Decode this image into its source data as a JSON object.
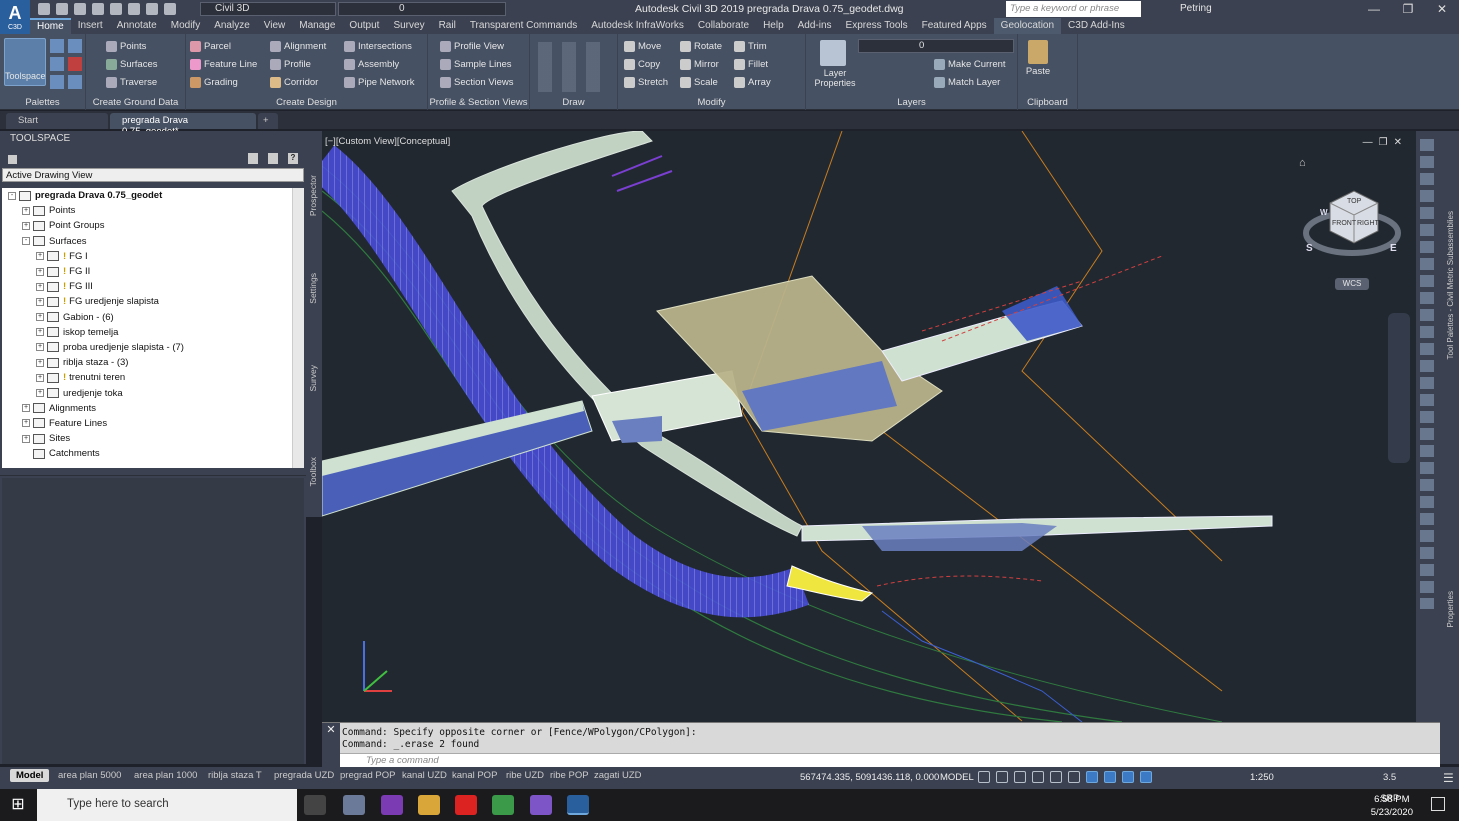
{
  "window": {
    "title": "Autodesk Civil 3D 2019    pregrada Drava 0.75_geodet.dwg",
    "workspace": "Civil 3D",
    "layer_current": "0",
    "search_placeholder": "Type a keyword or phrase",
    "user": "Petring",
    "app_letter": "A",
    "app_sub": "C3D"
  },
  "ribbon_tabs": [
    "Home",
    "Insert",
    "Annotate",
    "Modify",
    "Analyze",
    "View",
    "Manage",
    "Output",
    "Survey",
    "Rail",
    "Transparent Commands",
    "Autodesk InfraWorks",
    "Collaborate",
    "Help",
    "Add-ins",
    "Express Tools",
    "Featured Apps",
    "Geolocation",
    "C3D Add-Ins"
  ],
  "active_tab": "Home",
  "ribbon": {
    "toolspace": "Toolspace",
    "palettes": "Palettes",
    "ground": {
      "title": "Create Ground Data",
      "points": "Points",
      "surfaces": "Surfaces",
      "traverse": "Traverse"
    },
    "design": {
      "title": "Create Design",
      "parcel": "Parcel",
      "feature_line": "Feature Line",
      "grading": "Grading",
      "alignment": "Alignment",
      "profile": "Profile",
      "corridor": "Corridor",
      "intersections": "Intersections",
      "assembly": "Assembly",
      "pipe_network": "Pipe Network"
    },
    "profile_section": {
      "title": "Profile & Section Views",
      "profile_view": "Profile View",
      "sample_lines": "Sample Lines",
      "section_views": "Section Views"
    },
    "draw": {
      "title": "Draw"
    },
    "modify": {
      "title": "Modify",
      "move": "Move",
      "rotate": "Rotate",
      "trim": "Trim",
      "copy": "Copy",
      "mirror": "Mirror",
      "fillet": "Fillet",
      "stretch": "Stretch",
      "scale": "Scale",
      "array": "Array"
    },
    "layers": {
      "title": "Layers",
      "layer_properties": "Layer Properties",
      "make_current": "Make Current",
      "match_layer": "Match Layer",
      "current": "0"
    },
    "clipboard": {
      "title": "Clipboard",
      "paste": "Paste"
    }
  },
  "doc_tabs": [
    "Start",
    "pregrada Drava 0.75_geodet*"
  ],
  "toolspace": {
    "title": "TOOLSPACE",
    "view_select": "Active Drawing View",
    "side_tabs": [
      "Prospector",
      "Settings",
      "Survey",
      "Toolbox"
    ],
    "tree": [
      {
        "label": "pregrada Drava 0.75_geodet",
        "level": 0,
        "exp": "-",
        "bold": true,
        "warn": false
      },
      {
        "label": "Points",
        "level": 1,
        "exp": "+",
        "bold": false,
        "warn": false
      },
      {
        "label": "Point Groups",
        "level": 1,
        "exp": "+",
        "bold": false,
        "warn": false
      },
      {
        "label": "Surfaces",
        "level": 1,
        "exp": "-",
        "bold": false,
        "warn": false
      },
      {
        "label": "FG I",
        "level": 2,
        "exp": "+",
        "bold": false,
        "warn": true
      },
      {
        "label": "FG II",
        "level": 2,
        "exp": "+",
        "bold": false,
        "warn": true
      },
      {
        "label": "FG III",
        "level": 2,
        "exp": "+",
        "bold": false,
        "warn": true
      },
      {
        "label": "FG uredjenje slapista",
        "level": 2,
        "exp": "+",
        "bold": false,
        "warn": true
      },
      {
        "label": "Gabion - (6)",
        "level": 2,
        "exp": "+",
        "bold": false,
        "warn": false
      },
      {
        "label": "iskop temelja",
        "level": 2,
        "exp": "+",
        "bold": false,
        "warn": false
      },
      {
        "label": "proba uredjenje slapista - (7)",
        "level": 2,
        "exp": "+",
        "bold": false,
        "warn": false
      },
      {
        "label": "riblja staza - (3)",
        "level": 2,
        "exp": "+",
        "bold": false,
        "warn": false
      },
      {
        "label": "trenutni teren",
        "level": 2,
        "exp": "+",
        "bold": false,
        "warn": true
      },
      {
        "label": "uredjenje toka",
        "level": 2,
        "exp": "+",
        "bold": false,
        "warn": false
      },
      {
        "label": "Alignments",
        "level": 1,
        "exp": "+",
        "bold": false,
        "warn": false
      },
      {
        "label": "Feature Lines",
        "level": 1,
        "exp": "+",
        "bold": false,
        "warn": false
      },
      {
        "label": "Sites",
        "level": 1,
        "exp": "+",
        "bold": false,
        "warn": false
      },
      {
        "label": "Catchments",
        "level": 1,
        "exp": "",
        "bold": false,
        "warn": false
      }
    ]
  },
  "viewport": {
    "label": "[−][Custom View][Conceptual]",
    "wcs": "WCS",
    "viewcube": {
      "front": "FRONT",
      "right": "RIGHT",
      "top": "TOP",
      "s": "S",
      "e": "E",
      "w": "W"
    }
  },
  "right_palettes": [
    "Tool Palettes - Civil Metric Subassemblies",
    "Properties"
  ],
  "command": {
    "line1": "Command: Specify opposite corner or [Fence/WPolygon/CPolygon]:",
    "line2": "Command: _.erase 2 found",
    "placeholder": "Type a command"
  },
  "layouts": [
    "Model",
    "area plan 5000",
    "area plan 1000",
    "riblja staza T",
    "pregrada UZD",
    "pregrad POP",
    "kanal UZD",
    "kanal POP",
    "ribe UZD",
    "ribe POP",
    "zagati UZD"
  ],
  "status": {
    "coords": "567474.335, 5091436.118, 0.000",
    "model": "MODEL",
    "scale": "1:250",
    "lineweight": "3.5"
  },
  "taskbar": {
    "search_placeholder": "Type here to search",
    "time": "6:58 PM",
    "date": "5/23/2020",
    "lang": "SRP"
  },
  "colors": {
    "accent": "#6fa8dc",
    "ribbon": "#465163",
    "viewport_bg": "#212830"
  }
}
